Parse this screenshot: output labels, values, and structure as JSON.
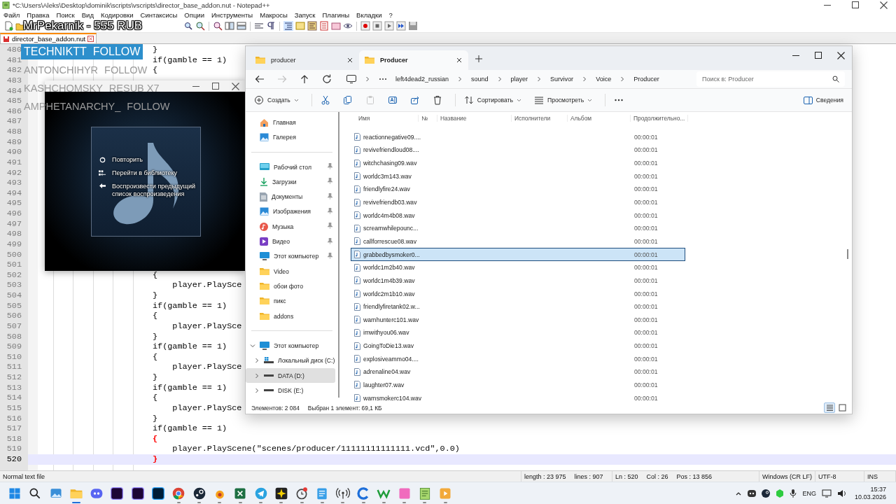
{
  "notepad": {
    "title": "*C:\\Users\\Aleks\\Desktop\\dominik\\scripts\\vscripts\\director_base_addon.nut - Notepad++",
    "menu": [
      "Файл",
      "Правка",
      "Поиск",
      "Вид",
      "Кодировки",
      "Синтаксисы",
      "Опции",
      "Инструменты",
      "Макросы",
      "Запуск",
      "Плагины",
      "Вкладки",
      "?"
    ],
    "tabs": [
      {
        "label": "director_base_addon.nut",
        "selected": true,
        "modified": true
      }
    ],
    "lines": [
      {
        "number": "480",
        "code": "}",
        "current": false,
        "matched": false
      },
      {
        "number": "481",
        "code": "if(gamble == 1)",
        "current": false,
        "matched": false
      },
      {
        "number": "482",
        "code": "{",
        "current": false,
        "matched": false
      },
      {
        "number": "483",
        "current": false
      },
      {
        "number": "484",
        "current": false
      },
      {
        "number": "485",
        "current": false
      },
      {
        "number": "486",
        "current": false
      },
      {
        "number": "487",
        "current": false
      },
      {
        "number": "488",
        "current": false
      },
      {
        "number": "489",
        "current": false
      },
      {
        "number": "490",
        "current": false
      },
      {
        "number": "491",
        "current": false
      },
      {
        "number": "492",
        "current": false
      },
      {
        "number": "493",
        "current": false
      },
      {
        "number": "494",
        "current": false
      },
      {
        "number": "495",
        "current": false
      },
      {
        "number": "496",
        "current": false
      },
      {
        "number": "497",
        "current": false
      },
      {
        "number": "498",
        "current": false
      },
      {
        "number": "499",
        "current": false
      },
      {
        "number": "500",
        "current": false
      },
      {
        "number": "501",
        "current": false
      },
      {
        "number": "502",
        "code": "{",
        "current": false,
        "matched": false
      },
      {
        "number": "503",
        "code": "    player.PlaySce",
        "current": false,
        "matched": false
      },
      {
        "number": "504",
        "code": "}",
        "current": false,
        "matched": false
      },
      {
        "number": "505",
        "code": "if(gamble == 1)",
        "current": false,
        "matched": false
      },
      {
        "number": "506",
        "code": "{",
        "current": false,
        "matched": false
      },
      {
        "number": "507",
        "code": "    player.PlaySce",
        "current": false,
        "matched": false
      },
      {
        "number": "508",
        "code": "}",
        "current": false,
        "matched": false
      },
      {
        "number": "509",
        "code": "if(gamble == 1)",
        "current": false,
        "matched": false
      },
      {
        "number": "510",
        "code": "{",
        "current": false,
        "matched": false
      },
      {
        "number": "511",
        "code": "    player.PlaySce",
        "current": false,
        "matched": false
      },
      {
        "number": "512",
        "code": "}",
        "current": false,
        "matched": false
      },
      {
        "number": "513",
        "code": "if(gamble == 1)",
        "current": false,
        "matched": false
      },
      {
        "number": "514",
        "code": "{",
        "current": false,
        "matched": false
      },
      {
        "number": "515",
        "code": "    player.PlaySce",
        "current": false,
        "matched": false
      },
      {
        "number": "516",
        "code": "}",
        "current": false,
        "matched": false
      },
      {
        "number": "517",
        "code": "if(gamble == 1)",
        "current": false,
        "matched": false
      },
      {
        "number": "518",
        "code": "{",
        "current": false,
        "matched": true
      },
      {
        "number": "519",
        "code": "    player.PlayScene(\"scenes/producer/11111111111111.vcd\",0.0)",
        "current": false,
        "matched": false
      },
      {
        "number": "520",
        "code": "}",
        "current": true,
        "matched": true
      }
    ],
    "status_bar": [
      [
        "Normal text file"
      ],
      [
        "length : 23 975",
        "lines : 907"
      ],
      [
        "Ln : 520",
        "Col : 26",
        "Pos : 13 856"
      ],
      [
        "Windows (CR LF)"
      ],
      [
        "UTF-8"
      ],
      [
        "INS"
      ]
    ]
  },
  "stream_overlay": {
    "donation": "MrPekarnik - 555 RUB",
    "alerts": [
      {
        "name": "TECHNIKTT",
        "action": "FOLLOW",
        "highlighted": true
      },
      {
        "name": "ANTONCHIHYR",
        "action": "FOLLOW",
        "highlighted": false
      },
      {
        "name": "KASHCHOMSKY",
        "action": "RESUB X7",
        "highlighted": false
      },
      {
        "name": "AMPHETANARCHY_",
        "action": "FOLLOW",
        "highlighted": false
      }
    ]
  },
  "media_player": {
    "menu": [
      {
        "kind": "repeat",
        "label": "Повторить"
      },
      {
        "kind": "library",
        "label": "Перейти в библиотеку"
      },
      {
        "kind": "previous",
        "label": "Воспроизвести предыдущий список воспроизведения"
      }
    ]
  },
  "explorer": {
    "tabs": [
      {
        "label": "producer",
        "selected": false
      },
      {
        "label": "Producer",
        "selected": true
      }
    ],
    "nav": [
      {
        "kind": "back",
        "disabled": false
      },
      {
        "kind": "forward",
        "disabled": true
      },
      {
        "kind": "up",
        "disabled": false
      },
      {
        "kind": "refresh",
        "disabled": false
      }
    ],
    "breadcrumb": [
      "left4dead2_russian",
      "sound",
      "player",
      "Survivor",
      "Voice",
      "Producer"
    ],
    "search": {
      "placeholder": "Поиск в: Producer"
    },
    "commands": [
      {
        "kind": "create",
        "label": "Создать",
        "dropdown": true,
        "disabled": false
      },
      {
        "kind": "cut",
        "disabled": false
      },
      {
        "kind": "copy",
        "disabled": false
      },
      {
        "kind": "paste",
        "disabled": true
      },
      {
        "kind": "rename",
        "disabled": false
      },
      {
        "kind": "share",
        "disabled": false
      },
      {
        "kind": "delete",
        "disabled": false
      },
      {
        "kind": "sort",
        "label": "Сортировать",
        "dropdown": true,
        "disabled": false
      },
      {
        "kind": "view",
        "label": "Просмотреть",
        "dropdown": true,
        "disabled": false
      },
      {
        "kind": "more",
        "disabled": false
      }
    ],
    "details_button": "Сведения",
    "sidebar": [
      {
        "items": [
          {
            "label": "Главная",
            "kind": "home",
            "pinned": false,
            "selected": false
          },
          {
            "label": "Галерея",
            "kind": "gallery",
            "pinned": false,
            "selected": false
          }
        ]
      },
      {
        "items": [
          {
            "label": "Рабочий стол",
            "kind": "desktop",
            "pinned": true,
            "selected": false
          },
          {
            "label": "Загрузки",
            "kind": "downloads",
            "pinned": true,
            "selected": false
          },
          {
            "label": "Документы",
            "kind": "documents",
            "pinned": true,
            "selected": false
          },
          {
            "label": "Изображения",
            "kind": "pictures",
            "pinned": true,
            "selected": false
          },
          {
            "label": "Музыка",
            "kind": "music",
            "pinned": true,
            "selected": false
          },
          {
            "label": "Видео",
            "kind": "videos",
            "pinned": true,
            "selected": false
          },
          {
            "label": "Этот компьютер",
            "kind": "computer",
            "pinned": true,
            "selected": false
          },
          {
            "label": "Video",
            "kind": "folder",
            "pinned": false,
            "selected": false
          },
          {
            "label": "обои фото",
            "kind": "folder",
            "pinned": false,
            "selected": false
          },
          {
            "label": "пикс",
            "kind": "folder",
            "pinned": false,
            "selected": false
          },
          {
            "label": "addons",
            "kind": "folder",
            "pinned": false,
            "selected": false
          }
        ]
      },
      {
        "items": [
          {
            "label": "Этот компьютер",
            "kind": "computer",
            "expanded": true,
            "selected": false,
            "children": [
              {
                "label": "Локальный диск (C:)",
                "kind": "system-drive",
                "expanded": false,
                "selected": false
              },
              {
                "label": "DATA (D:)",
                "kind": "drive",
                "expanded": false,
                "selected": true
              },
              {
                "label": "DISK (E:)",
                "kind": "drive",
                "expanded": false,
                "selected": false
              }
            ]
          }
        ]
      }
    ],
    "columns": [
      "Имя",
      "№",
      "Название",
      "Исполнители",
      "Альбом",
      "Продолжительно..."
    ],
    "files": [
      {
        "name": "reactionnegative09....",
        "duration": "00:00:01",
        "selected": false
      },
      {
        "name": "revivefriendloud08....",
        "duration": "00:00:01",
        "selected": false
      },
      {
        "name": "witchchasing09.wav",
        "duration": "00:00:01",
        "selected": false
      },
      {
        "name": "worldc3m143.wav",
        "duration": "00:00:01",
        "selected": false
      },
      {
        "name": "friendlyfire24.wav",
        "duration": "00:00:01",
        "selected": false
      },
      {
        "name": "revivefriendb03.wav",
        "duration": "00:00:01",
        "selected": false
      },
      {
        "name": "worldc4m4b08.wav",
        "duration": "00:00:01",
        "selected": false
      },
      {
        "name": "screamwhilepounc...",
        "duration": "00:00:01",
        "selected": false
      },
      {
        "name": "callforrescue08.wav",
        "duration": "00:00:01",
        "selected": false
      },
      {
        "name": "grabbedbysmoker0...",
        "duration": "00:00:01",
        "selected": true
      },
      {
        "name": "worldc1m2b40.wav",
        "duration": "00:00:01",
        "selected": false
      },
      {
        "name": "worldc1m4b39.wav",
        "duration": "00:00:01",
        "selected": false
      },
      {
        "name": "worldc2m1b10.wav",
        "duration": "00:00:01",
        "selected": false
      },
      {
        "name": "friendlyfiretank02.w...",
        "duration": "00:00:01",
        "selected": false
      },
      {
        "name": "warnhunterc101.wav",
        "duration": "00:00:01",
        "selected": false
      },
      {
        "name": "imwithyou06.wav",
        "duration": "00:00:01",
        "selected": false
      },
      {
        "name": "GoingToDie13.wav",
        "duration": "00:00:01",
        "selected": false
      },
      {
        "name": "explosiveammo04....",
        "duration": "00:00:01",
        "selected": false
      },
      {
        "name": "adrenaline04.wav",
        "duration": "00:00:01",
        "selected": false
      },
      {
        "name": "laughter07.wav",
        "duration": "00:00:01",
        "selected": false
      },
      {
        "name": "warnsmokerc104.wav",
        "duration": "00:00:01",
        "selected": false
      }
    ],
    "status": [
      "Элементов: 2 084",
      "Выбран 1 элемент: 69,1 КБ"
    ],
    "views": [
      {
        "kind": "details",
        "selected": true
      },
      {
        "kind": "tiles",
        "selected": false
      }
    ]
  },
  "taskbar": {
    "apps": [
      {
        "kind": "start",
        "running": false,
        "selected": false
      },
      {
        "kind": "search",
        "running": false,
        "selected": false
      },
      {
        "kind": "widgets",
        "running": false,
        "selected": false
      },
      {
        "kind": "files",
        "running": true,
        "selected": true
      },
      {
        "kind": "chat",
        "running": false,
        "selected": false
      },
      {
        "kind": "video-editor",
        "running": false,
        "selected": false
      },
      {
        "kind": "video-editor",
        "running": false,
        "selected": false
      },
      {
        "kind": "photo-editor",
        "running": false,
        "selected": false
      },
      {
        "kind": "browser",
        "running": true,
        "selected": false
      },
      {
        "kind": "game-store",
        "running": true,
        "selected": false
      },
      {
        "kind": "ball",
        "running": true,
        "selected": false
      },
      {
        "kind": "sheet",
        "running": true,
        "selected": false
      },
      {
        "kind": "messenger",
        "running": true,
        "selected": false
      },
      {
        "kind": "sparkle",
        "running": true,
        "selected": false
      },
      {
        "kind": "clock",
        "running": true,
        "selected": false
      },
      {
        "kind": "notes",
        "running": true,
        "selected": false
      },
      {
        "kind": "broadcast",
        "running": true,
        "selected": false
      },
      {
        "kind": "ring",
        "running": true,
        "selected": false
      },
      {
        "kind": "zigzag",
        "running": true,
        "selected": false
      },
      {
        "kind": "pink-square",
        "running": true,
        "selected": false
      },
      {
        "kind": "notepad",
        "running": true,
        "selected": false
      },
      {
        "kind": "player",
        "running": true,
        "selected": false
      }
    ],
    "language": "ENG",
    "time": "15:37",
    "date": "10.03.2026"
  }
}
